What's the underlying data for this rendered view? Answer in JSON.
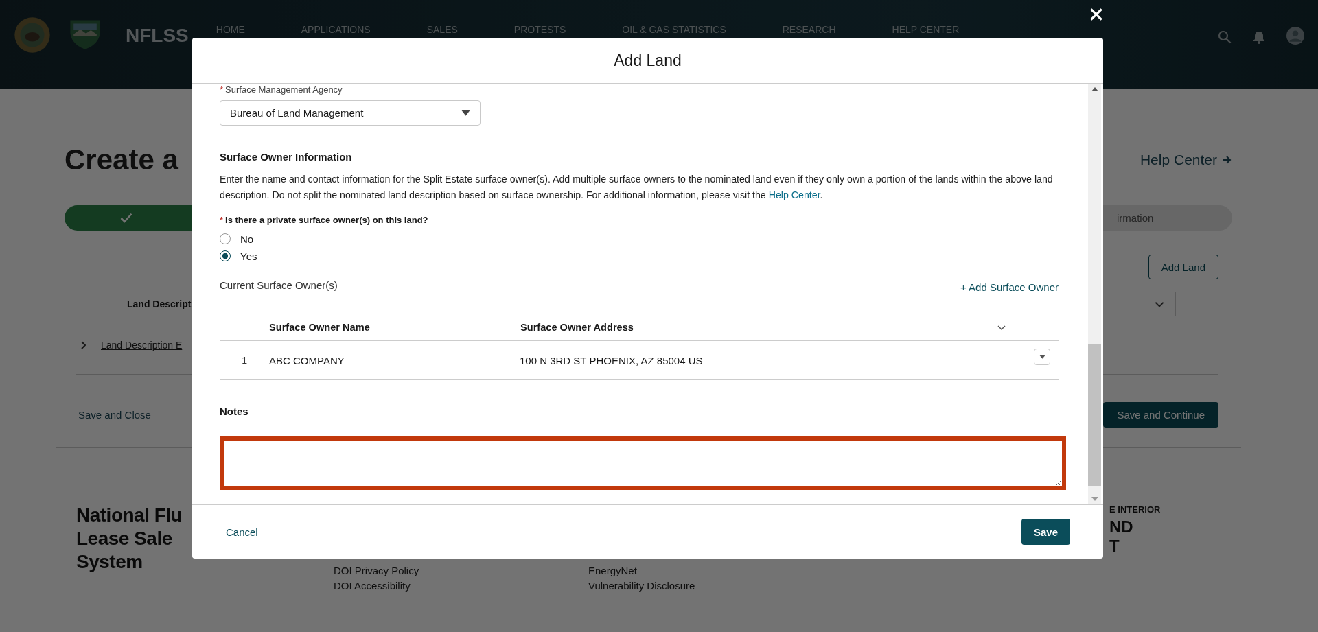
{
  "header": {
    "brand": "NFLSS",
    "nav": [
      {
        "label": "HOME"
      },
      {
        "label": "APPLICATIONS"
      },
      {
        "label": "SALES"
      },
      {
        "label": "PROTESTS"
      },
      {
        "label": "OIL & GAS STATISTICS"
      },
      {
        "label": "RESEARCH"
      },
      {
        "label": "HELP CENTER"
      }
    ]
  },
  "page": {
    "title": "Create a",
    "help_link": "Help Center",
    "progress": [
      {
        "completed": true
      },
      {
        "completed": false,
        "label": "irmation"
      }
    ],
    "add_land_button": "Add Land",
    "table": {
      "column_1": "Land Descript",
      "rows": [
        {
          "label": "Land Description E",
          "expanded": false
        }
      ]
    },
    "save_close": "Save and Close",
    "save_continue": "Save and Continue"
  },
  "footer": {
    "title_lines": [
      "National Flu",
      "Lease Sale",
      "System"
    ],
    "links_column_1": [
      "DOI Privacy Policy",
      "DOI Accessibility"
    ],
    "links_column_2": [
      "EnergyNet",
      "Vulnerability Disclosure"
    ],
    "agency_lines": [
      "E INTERIOR",
      "ND",
      "T"
    ]
  },
  "modal": {
    "title": "Add Land",
    "agency_field": {
      "required_mark": "*",
      "label": "Surface Management Agency",
      "value": "Bureau of Land Management"
    },
    "section_title": "Surface Owner Information",
    "description": "Enter the name and contact information for the Split Estate surface owner(s). Add multiple surface owners to the nominated land even if they only own a portion of the lands within the above land description. Do not split the nominated land description based on surface ownership. For additional information, please visit the ",
    "description_link": "Help Center",
    "description_end": ".",
    "question": {
      "required_mark": "*",
      "label": "Is there a private surface owner(s) on this land?",
      "options": [
        {
          "label": "No",
          "selected": false
        },
        {
          "label": "Yes",
          "selected": true
        }
      ]
    },
    "owners_label": "Current Surface Owner(s)",
    "add_owner_link": "+ Add Surface Owner",
    "owners_table": {
      "columns": [
        "Surface Owner Name",
        "Surface Owner Address"
      ],
      "rows": [
        {
          "number": "1",
          "name": "ABC COMPANY",
          "address": "100 N 3RD ST PHOENIX, AZ 85004 US"
        }
      ]
    },
    "notes_label": "Notes",
    "notes_invalid": true,
    "cancel": "Cancel",
    "save": "Save"
  }
}
